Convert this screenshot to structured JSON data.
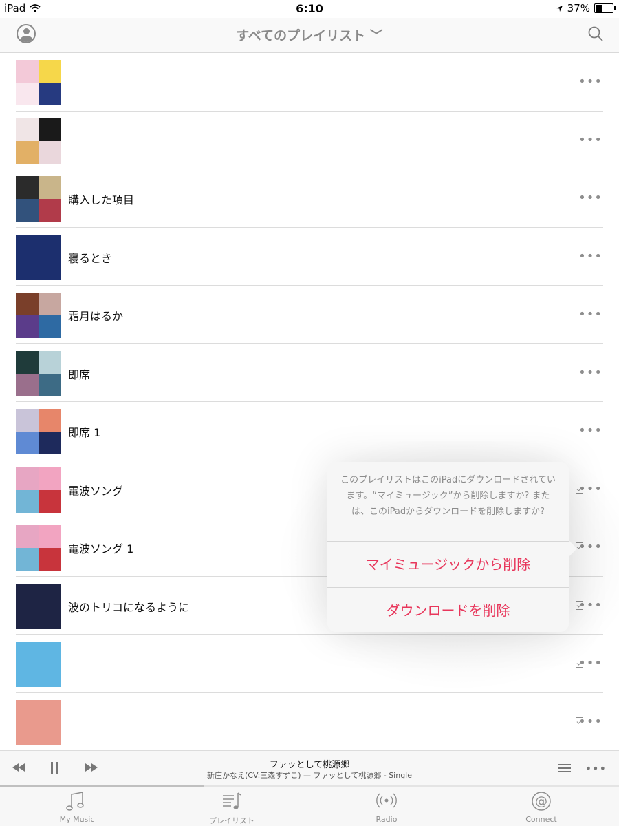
{
  "status_bar": {
    "device": "iPad",
    "time": "6:10",
    "battery_percent": "37%",
    "battery_level": 0.37
  },
  "nav": {
    "title": "すべてのプレイリスト ﹀"
  },
  "playlists": [
    {
      "name": "",
      "art": [
        "#f3c9d8",
        "#f6d74a",
        "#f9e7ee",
        "#263a80"
      ],
      "downloaded": false
    },
    {
      "name": "",
      "art": [
        "#f0e5e6",
        "#1a1a1a",
        "#e2b066",
        "#ead7dc"
      ],
      "downloaded": false
    },
    {
      "name": "購入した項目",
      "art": [
        "#2b2b2b",
        "#c9b58a",
        "#32527c",
        "#b13b4a"
      ],
      "downloaded": false
    },
    {
      "name": "寝るとき",
      "art": [
        "#1c2f6e"
      ],
      "downloaded": false
    },
    {
      "name": "霜月はるか",
      "art": [
        "#7a3f2a",
        "#c7a7a0",
        "#5b3c8a",
        "#2e6aa3"
      ],
      "downloaded": false
    },
    {
      "name": "即席",
      "art": [
        "#1f3b3a",
        "#b8d2d8",
        "#9a6f8c",
        "#3d6b85"
      ],
      "downloaded": false
    },
    {
      "name": "即席 1",
      "art": [
        "#c9c4d9",
        "#e7866a",
        "#5f8ad4",
        "#1e2a5c"
      ],
      "downloaded": false
    },
    {
      "name": "電波ソング",
      "art": [
        "#e7a6c3",
        "#f2a4c1",
        "#72b5d6",
        "#c8343c"
      ],
      "downloaded": true
    },
    {
      "name": "電波ソング 1",
      "art": [
        "#e7a6c3",
        "#f2a4c1",
        "#72b5d6",
        "#c8343c"
      ],
      "downloaded": true
    },
    {
      "name": "波のトリコになるように",
      "art": [
        "#1e2444"
      ],
      "downloaded": true
    },
    {
      "name": "",
      "art": [
        "#5fb6e3"
      ],
      "downloaded": true
    },
    {
      "name": "",
      "art": [
        "#e99a8d"
      ],
      "downloaded": true
    }
  ],
  "popover": {
    "message": "このプレイリストはこのiPadにダウンロードされています。“マイミュージック”から削除しますか? または、このiPadからダウンロードを削除しますか?",
    "remove_from_library": "マイミュージックから削除",
    "remove_download": "ダウンロードを削除",
    "accent_color": "#e8365b"
  },
  "player": {
    "song": "ファッとして桃源郷",
    "subtitle": "新庄かなえ(CV:三森すずこ) — ファッとして桃源郷 - Single",
    "progress": 0.33
  },
  "tabs": [
    {
      "label": "My Music",
      "icon": "music-note-icon"
    },
    {
      "label": "プレイリスト",
      "icon": "playlist-icon"
    },
    {
      "label": "Radio",
      "icon": "radio-icon"
    },
    {
      "label": "Connect",
      "icon": "at-sign-icon"
    }
  ]
}
